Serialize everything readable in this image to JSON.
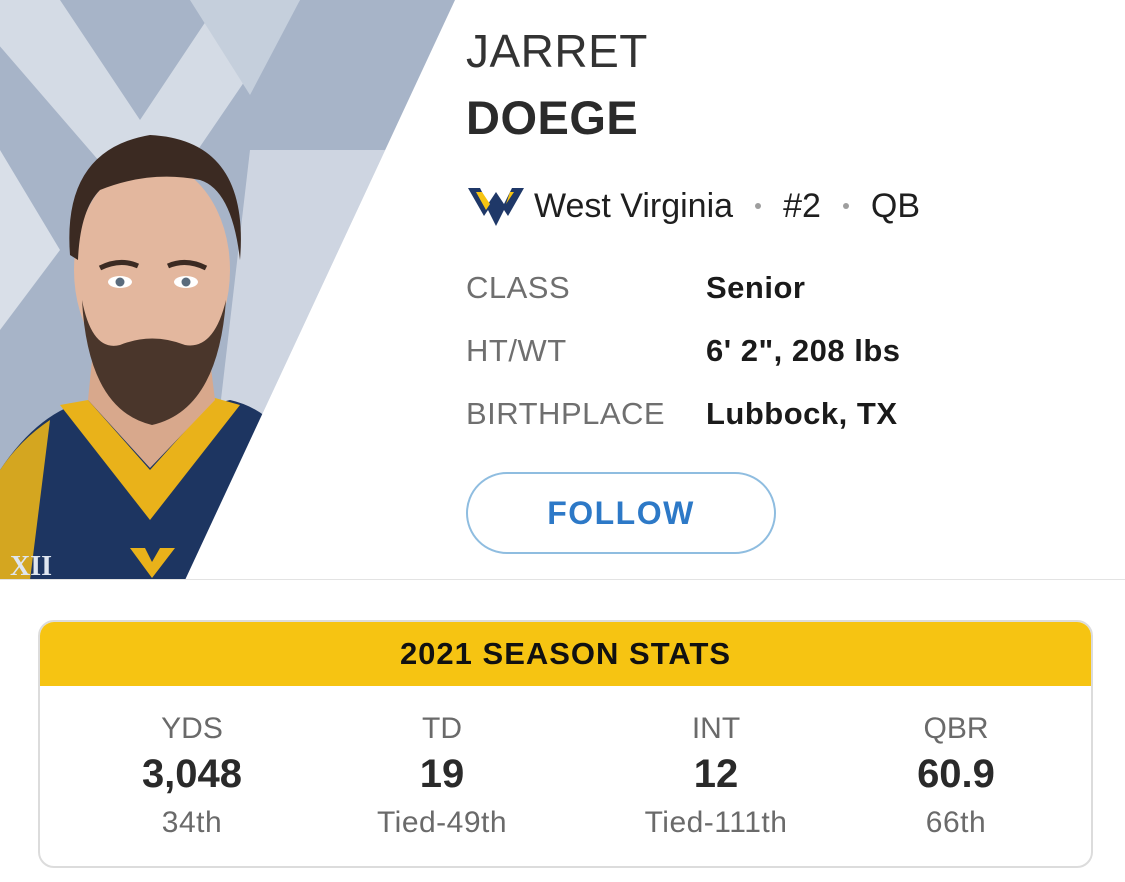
{
  "player": {
    "first_name": "JARRET",
    "last_name": "DOEGE",
    "team": "West Virginia",
    "number": "#2",
    "position": "QB",
    "team_logo": "wv-logo-icon",
    "photo": "player-headshot"
  },
  "bio": [
    {
      "label": "CLASS",
      "value": "Senior"
    },
    {
      "label": "HT/WT",
      "value": "6' 2\", 208 lbs"
    },
    {
      "label": "BIRTHPLACE",
      "value": "Lubbock, TX"
    }
  ],
  "follow_label": "FOLLOW",
  "stats": {
    "title": "2021 SEASON STATS",
    "items": [
      {
        "label": "YDS",
        "value": "3,048",
        "rank": "34th"
      },
      {
        "label": "TD",
        "value": "19",
        "rank": "Tied-49th"
      },
      {
        "label": "INT",
        "value": "12",
        "rank": "Tied-111th"
      },
      {
        "label": "QBR",
        "value": "60.9",
        "rank": "66th"
      }
    ]
  },
  "colors": {
    "accent_gold": "#f6c412",
    "navy": "#1f3868",
    "link_blue": "#2d79c7",
    "hero_slate": "#a3b1c5"
  }
}
